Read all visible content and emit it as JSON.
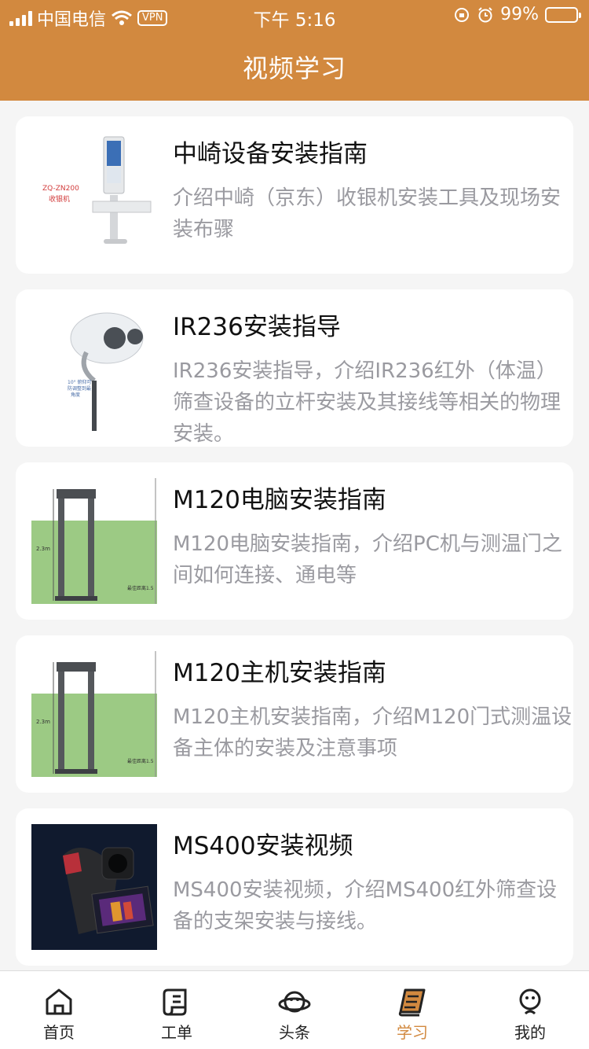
{
  "status_bar": {
    "carrier": "中国电信",
    "vpn": "VPN",
    "time": "下午 5:16",
    "battery": "99%"
  },
  "header": {
    "title": "视频学习"
  },
  "colors": {
    "accent": "#d2893f",
    "muted": "#9a9aa0"
  },
  "videos": [
    {
      "title": "中崎设备安装指南",
      "desc": "介绍中崎（京东）收银机安装工具及现场安装布骤",
      "thumb_text": [
        "ZQ-ZN200",
        "收银机"
      ]
    },
    {
      "title": "IR236安装指导",
      "desc": "IR236安装指导，介绍IR236红外（体温）筛查设备的立杆安装及其接线等相关的物理安装。",
      "thumb_text": [
        "10° 俯仰可",
        "防调整到最",
        "角度"
      ]
    },
    {
      "title": "M120电脑安装指南",
      "desc": "M120电脑安装指南，介绍PC机与测温门之间如何连接、通电等",
      "thumb_text": [
        "2.3m",
        "最佳距离1.5"
      ]
    },
    {
      "title": "M120主机安装指南",
      "desc": "M120主机安装指南，介绍M120门式测温设备主体的安装及注意事项",
      "thumb_text": [
        "2.3m",
        "最佳距离1.5"
      ]
    },
    {
      "title": "MS400安装视频",
      "desc": "MS400安装视频，介绍MS400红外筛查设备的支架安装与接线。",
      "thumb_text": []
    }
  ],
  "tabs": [
    {
      "label": "首页",
      "icon": "home-icon"
    },
    {
      "label": "工单",
      "icon": "scroll-icon"
    },
    {
      "label": "头条",
      "icon": "planet-icon"
    },
    {
      "label": "学习",
      "icon": "book-icon",
      "active": true
    },
    {
      "label": "我的",
      "icon": "person-icon"
    }
  ]
}
